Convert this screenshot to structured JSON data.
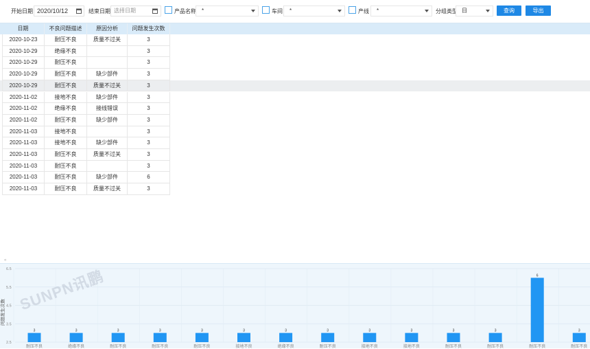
{
  "toolbar": {
    "start_date_label": "开始日期",
    "start_date_value": "2020/10/12",
    "end_date_label": "结束日期",
    "end_date_placeholder": "选择日期",
    "product_label": "产品名称",
    "product_value": "*",
    "workshop_label": "车间",
    "workshop_value": "*",
    "line_label": "产线",
    "line_value": "*",
    "group_type_label": "分组类型",
    "group_type_value": "日",
    "query_label": "查询",
    "export_label": "导出"
  },
  "table": {
    "headers": [
      "日期",
      "不良问题描述",
      "原因分析",
      "问题发生次数"
    ],
    "rows": [
      [
        "2020-10-23",
        "耐压不良",
        "质量不过关",
        "3"
      ],
      [
        "2020-10-29",
        "绝缘不良",
        "",
        "3"
      ],
      [
        "2020-10-29",
        "耐压不良",
        "",
        "3"
      ],
      [
        "2020-10-29",
        "耐压不良",
        "缺少部件",
        "3"
      ],
      [
        "2020-10-29",
        "耐压不良",
        "质量不过关",
        "3"
      ],
      [
        "2020-11-02",
        "接地不良",
        "缺少部件",
        "3"
      ],
      [
        "2020-11-02",
        "绝缘不良",
        "接线错误",
        "3"
      ],
      [
        "2020-11-02",
        "耐压不良",
        "缺少部件",
        "3"
      ],
      [
        "2020-11-03",
        "接地不良",
        "",
        "3"
      ],
      [
        "2020-11-03",
        "接地不良",
        "缺少部件",
        "3"
      ],
      [
        "2020-11-03",
        "耐压不良",
        "质量不过关",
        "3"
      ],
      [
        "2020-11-03",
        "耐压不良",
        "",
        "3"
      ],
      [
        "2020-11-03",
        "耐压不良",
        "缺少部件",
        "6"
      ],
      [
        "2020-11-03",
        "耐压不良",
        "质量不过关",
        "3"
      ]
    ],
    "highlighted_row": 4
  },
  "watermark": "SUNPN讯鹏",
  "colors": {
    "accent": "#1e88e5",
    "bar": "#2196f3",
    "header_bg": "#d9ebf9",
    "chart_bg": "#eef6fc"
  },
  "chart_data": {
    "type": "bar",
    "ylabel": "问题发生次数",
    "yticks": [
      "6.5",
      "5.5",
      "4.5",
      "3.5",
      "2.5"
    ],
    "ylim": [
      2.5,
      6.5
    ],
    "categories": [
      "耐压不良",
      "绝缘不良",
      "耐压不良",
      "耐压不良",
      "耐压不良",
      "接地不良",
      "绝缘不良",
      "耐压不良",
      "接地不良",
      "接地不良",
      "耐压不良",
      "耐压不良",
      "耐压不良",
      "耐压不良"
    ],
    "values": [
      3,
      3,
      3,
      3,
      3,
      3,
      3,
      3,
      3,
      3,
      3,
      3,
      6,
      3
    ],
    "data_labels": [
      "3",
      "3",
      "3",
      "3",
      "3",
      "3",
      "3",
      "3",
      "3",
      "3",
      "3",
      "3",
      "6",
      "3"
    ],
    "grid": true
  }
}
